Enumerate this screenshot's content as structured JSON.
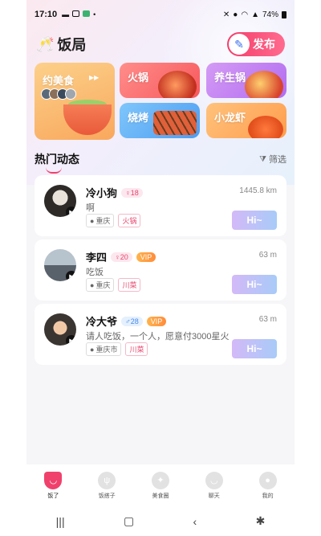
{
  "status_bar": {
    "time": "17:10",
    "battery": "74%"
  },
  "header": {
    "title": "饭局",
    "publish_label": "发布"
  },
  "categories": {
    "featured": "约美食",
    "items": [
      "火锅",
      "养生锅",
      "烧烤",
      "小龙虾"
    ]
  },
  "section": {
    "title": "热门动态",
    "filter_label": "筛选"
  },
  "feed": [
    {
      "name": "冷小狗",
      "gender": "♀",
      "age": "18",
      "vip": "",
      "distance": "1445.8 km",
      "message": "啊",
      "location": "重庆",
      "category": "火锅",
      "hi": "Hi~"
    },
    {
      "name": "李四",
      "gender": "♀",
      "age": "20",
      "vip": "VIP",
      "distance": "63 m",
      "message": "吃饭",
      "location": "重庆",
      "category": "川菜",
      "hi": "Hi~"
    },
    {
      "name": "冷大爷",
      "gender": "♂",
      "age": "28",
      "vip": "VIP",
      "distance": "63 m",
      "message": "请人吃饭，一个人，愿意付3000星火",
      "location": "重庆市",
      "category": "川菜",
      "hi": "Hi~"
    }
  ],
  "tabbar": [
    "饭了",
    "饭搭子",
    "美食圈",
    "聊天",
    "我的"
  ],
  "colors": {
    "accent": "#f0416c",
    "vip": "#ff9a3d"
  }
}
